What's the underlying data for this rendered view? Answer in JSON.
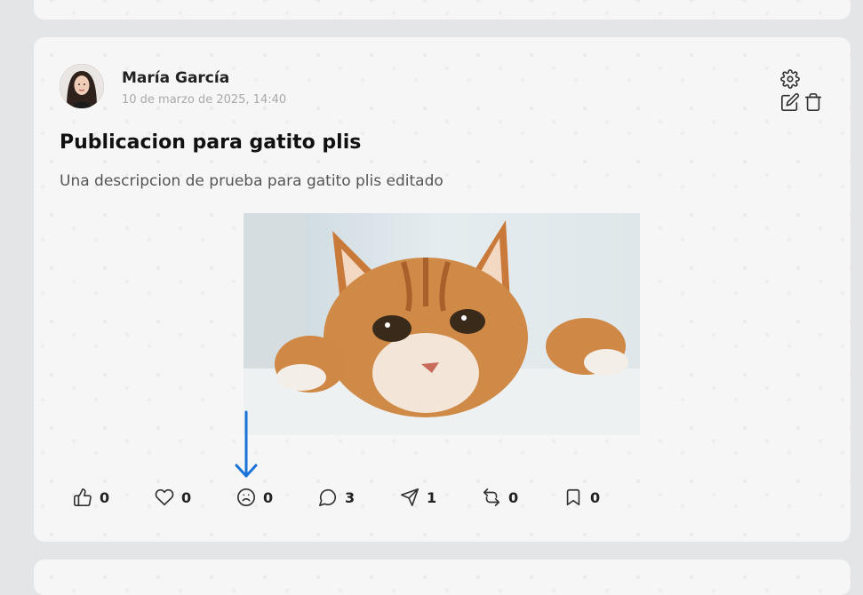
{
  "post": {
    "author": "María García",
    "date": "10 de marzo de 2025, 14:40",
    "title": "Publicacion para gatito plis",
    "description": "Una descripcion de prueba para gatito plis editado"
  },
  "actions": [
    {
      "name": "like-button",
      "icon": "thumbs-up-icon",
      "count": "0"
    },
    {
      "name": "love-button",
      "icon": "heart-icon",
      "count": "0"
    },
    {
      "name": "sad-button",
      "icon": "frown-icon",
      "count": "0"
    },
    {
      "name": "comment-button",
      "icon": "message-circle-icon",
      "count": "3"
    },
    {
      "name": "share-button",
      "icon": "send-icon",
      "count": "1"
    },
    {
      "name": "repost-button",
      "icon": "repeat-icon",
      "count": "0"
    },
    {
      "name": "bookmark-button",
      "icon": "bookmark-icon",
      "count": "0"
    }
  ],
  "colors": {
    "arrow": "#1a73d9",
    "icon": "#333333",
    "card": "#f6f6f6",
    "background": "#e4e5e7"
  }
}
